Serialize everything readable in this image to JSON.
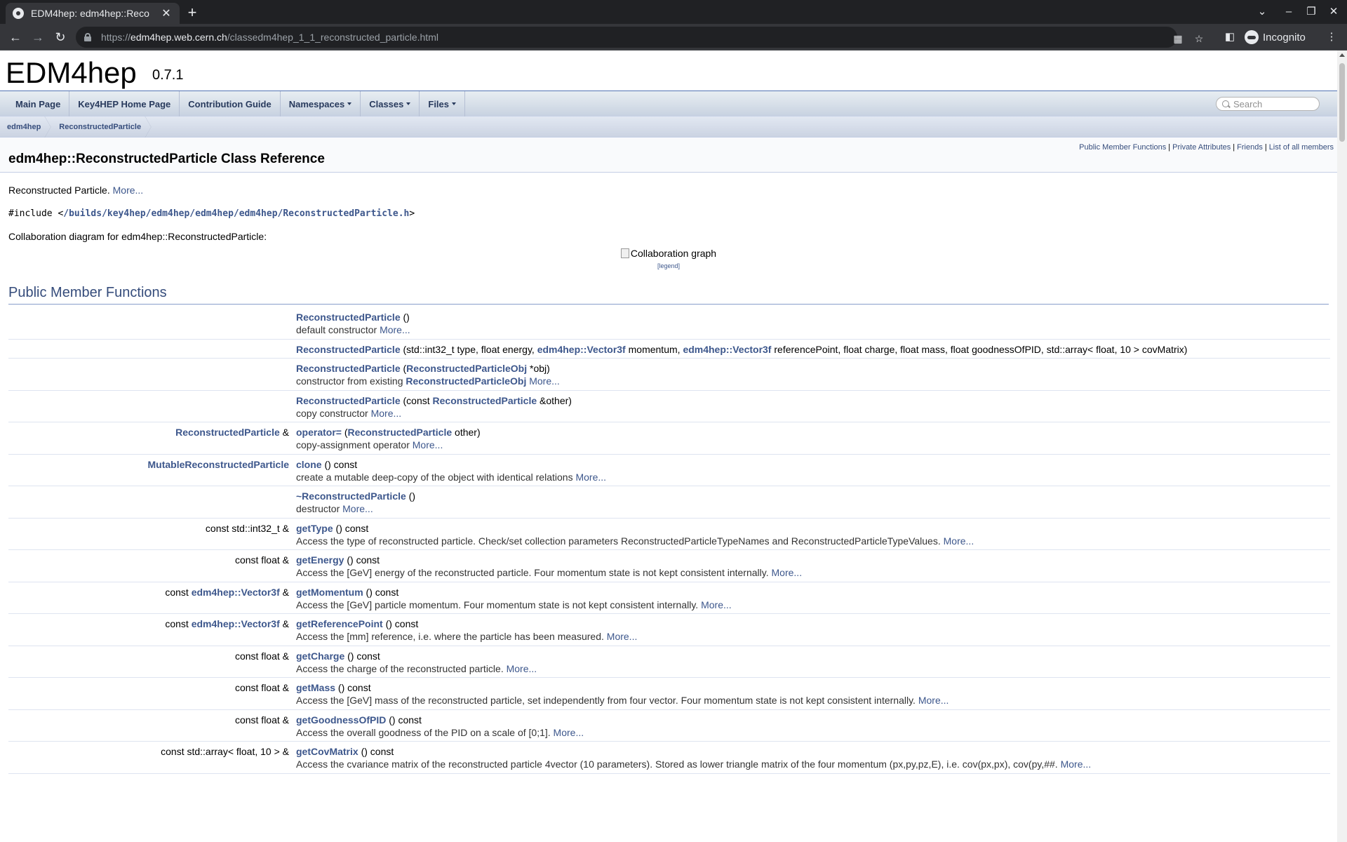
{
  "browser": {
    "tab_title": "EDM4hep: edm4hep::Reco",
    "url_prefix": "https://",
    "url_host": "edm4hep.web.cern.ch",
    "url_path": "/classedm4hep_1_1_reconstructed_particle.html",
    "incognito_label": "Incognito"
  },
  "project": {
    "name": "EDM4hep",
    "number": "0.7.1"
  },
  "nav": {
    "items": [
      {
        "label": "Main Page"
      },
      {
        "label": "Key4HEP Home Page"
      },
      {
        "label": "Contribution Guide"
      },
      {
        "label": "Namespaces"
      },
      {
        "label": "Classes"
      },
      {
        "label": "Files"
      }
    ],
    "search_placeholder": "Search"
  },
  "breadcrumb": [
    "edm4hep",
    "ReconstructedParticle"
  ],
  "summary": [
    "Public Member Functions",
    "Private Attributes",
    "Friends",
    "List of all members"
  ],
  "title": "edm4hep::ReconstructedParticle Class Reference",
  "brief": {
    "text": "Reconstructed Particle.",
    "more": "More..."
  },
  "include": {
    "prefix": "#include <",
    "path": "/builds/key4hep/edm4hep/edm4hep/edm4hep/ReconstructedParticle.h",
    "suffix": ">"
  },
  "collab": {
    "label": "Collaboration diagram for edm4hep::ReconstructedParticle:",
    "alt": "Collaboration graph",
    "legend": "[legend]"
  },
  "section_title": "Public Member Functions",
  "members": [
    {
      "ret_pre": "",
      "ret_link": "",
      "ret_post": "",
      "name": "ReconstructedParticle",
      "sig": [
        {
          "t": " ()"
        }
      ],
      "desc": "default constructor",
      "more": "More..."
    },
    {
      "ret_pre": "",
      "ret_link": "",
      "ret_post": "",
      "name": "ReconstructedParticle",
      "sig": [
        {
          "t": " (std::int32_t type, float energy, "
        },
        {
          "l": "edm4hep::Vector3f"
        },
        {
          "t": " momentum, "
        },
        {
          "l": "edm4hep::Vector3f"
        },
        {
          "t": " referencePoint, float charge, float mass, float goodnessOfPID, std::array< float, 10 > covMatrix)"
        }
      ],
      "desc": "",
      "more": ""
    },
    {
      "ret_pre": "",
      "ret_link": "",
      "ret_post": "",
      "name": "ReconstructedParticle",
      "sig": [
        {
          "t": " ("
        },
        {
          "l": "ReconstructedParticleObj"
        },
        {
          "t": " *obj)"
        }
      ],
      "desc": "constructor from existing ",
      "desc_link": "ReconstructedParticleObj",
      "more": "More..."
    },
    {
      "ret_pre": "",
      "ret_link": "",
      "ret_post": "",
      "name": "ReconstructedParticle",
      "sig": [
        {
          "t": " (const "
        },
        {
          "l": "ReconstructedParticle"
        },
        {
          "t": " &other)"
        }
      ],
      "desc": "copy constructor",
      "more": "More..."
    },
    {
      "ret_pre": "",
      "ret_link": "ReconstructedParticle",
      "ret_post": " &",
      "name": "operator=",
      "sig": [
        {
          "t": " ("
        },
        {
          "l": "ReconstructedParticle"
        },
        {
          "t": " other)"
        }
      ],
      "desc": "copy-assignment operator",
      "more": "More..."
    },
    {
      "ret_pre": "",
      "ret_link": "MutableReconstructedParticle",
      "ret_post": "",
      "name": "clone",
      "sig": [
        {
          "t": " () const"
        }
      ],
      "desc": "create a mutable deep-copy of the object with identical relations",
      "more": "More..."
    },
    {
      "ret_pre": "",
      "ret_link": "",
      "ret_post": "",
      "name": "~ReconstructedParticle",
      "sig": [
        {
          "t": " ()"
        }
      ],
      "desc": "destructor",
      "more": "More..."
    },
    {
      "ret_pre": "const std::int32_t &",
      "ret_link": "",
      "ret_post": "",
      "name": "getType",
      "sig": [
        {
          "t": " () const"
        }
      ],
      "desc": "Access the type of reconstructed particle. Check/set collection parameters ReconstructedParticleTypeNames and ReconstructedParticleTypeValues.",
      "more": "More..."
    },
    {
      "ret_pre": "const float &",
      "ret_link": "",
      "ret_post": "",
      "name": "getEnergy",
      "sig": [
        {
          "t": " () const"
        }
      ],
      "desc": "Access the [GeV] energy of the reconstructed particle. Four momentum state is not kept consistent internally.",
      "more": "More..."
    },
    {
      "ret_pre": "const ",
      "ret_link": "edm4hep::Vector3f",
      "ret_post": " &",
      "name": "getMomentum",
      "sig": [
        {
          "t": " () const"
        }
      ],
      "desc": "Access the [GeV] particle momentum. Four momentum state is not kept consistent internally.",
      "more": "More..."
    },
    {
      "ret_pre": "const ",
      "ret_link": "edm4hep::Vector3f",
      "ret_post": " &",
      "name": "getReferencePoint",
      "sig": [
        {
          "t": " () const"
        }
      ],
      "desc": "Access the [mm] reference, i.e. where the particle has been measured.",
      "more": "More..."
    },
    {
      "ret_pre": "const float &",
      "ret_link": "",
      "ret_post": "",
      "name": "getCharge",
      "sig": [
        {
          "t": " () const"
        }
      ],
      "desc": "Access the charge of the reconstructed particle.",
      "more": "More..."
    },
    {
      "ret_pre": "const float &",
      "ret_link": "",
      "ret_post": "",
      "name": "getMass",
      "sig": [
        {
          "t": " () const"
        }
      ],
      "desc": "Access the [GeV] mass of the reconstructed particle, set independently from four vector. Four momentum state is not kept consistent internally.",
      "more": "More..."
    },
    {
      "ret_pre": "const float &",
      "ret_link": "",
      "ret_post": "",
      "name": "getGoodnessOfPID",
      "sig": [
        {
          "t": " () const"
        }
      ],
      "desc": "Access the overall goodness of the PID on a scale of [0;1].",
      "more": "More..."
    },
    {
      "ret_pre": "const std::array< float, 10 > &",
      "ret_link": "",
      "ret_post": "",
      "name": "getCovMatrix",
      "sig": [
        {
          "t": " () const"
        }
      ],
      "desc": "Access the cvariance matrix of the reconstructed particle 4vector (10 parameters). Stored as lower triangle matrix of the four momentum (px,py,pz,E), i.e. cov(px,px), cov(py,##.",
      "more": "More..."
    }
  ]
}
